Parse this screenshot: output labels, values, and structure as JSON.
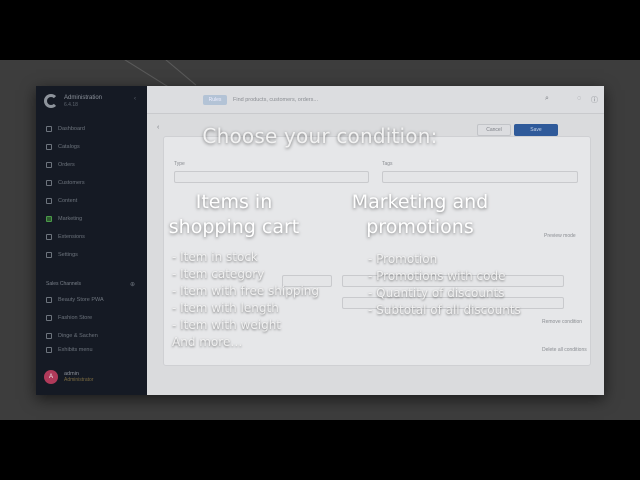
{
  "overlay": {
    "title": "Choose your condition:",
    "left_column": {
      "heading_line1": "Items in",
      "heading_line2": "shopping cart",
      "items": [
        "- Item in stock",
        "- Item category",
        "- Item with free shipping",
        "- Item with length",
        "- Item with weight",
        "And more…"
      ]
    },
    "right_column": {
      "heading_line1": "Marketing and",
      "heading_line2": "promotions",
      "items": [
        "- Promotion",
        "- Promotions with code",
        "- Quantity of discounts",
        "- Subtotal of all discounts"
      ]
    }
  },
  "app": {
    "brand_title": "Administration",
    "brand_sub": "6.4.18",
    "nav": [
      {
        "label": "Dashboard",
        "icon": "dashboard-icon"
      },
      {
        "label": "Catalogs",
        "icon": "catalog-icon"
      },
      {
        "label": "Orders",
        "icon": "orders-icon"
      },
      {
        "label": "Customers",
        "icon": "customers-icon"
      },
      {
        "label": "Content",
        "icon": "content-icon"
      },
      {
        "label": "Marketing",
        "icon": "marketing-icon"
      },
      {
        "label": "Extensions",
        "icon": "extensions-icon"
      },
      {
        "label": "Settings",
        "icon": "settings-icon"
      }
    ],
    "sales_channels_label": "Sales Channels",
    "channels": [
      {
        "label": "Beauty Store PWA"
      },
      {
        "label": "Fashion Store"
      },
      {
        "label": "Dinge & Sachen"
      },
      {
        "label": "Exhibits menu"
      }
    ],
    "user": {
      "initial": "A",
      "name": "admin",
      "role": "Administrator"
    },
    "search_tag": "Rules",
    "search_placeholder": "Find products, customers, orders...",
    "cancel_label": "Cancel",
    "save_label": "Save",
    "type_label": "Type",
    "tags_label": "Tags",
    "preview_label": "Preview mode",
    "remove_label": "Remove condition",
    "delete_label": "Delete all conditions"
  },
  "colors": {
    "sidebar_bg": "#151a24",
    "accent_blue": "#2f5a9a",
    "overlay_text": "#ffffff"
  }
}
